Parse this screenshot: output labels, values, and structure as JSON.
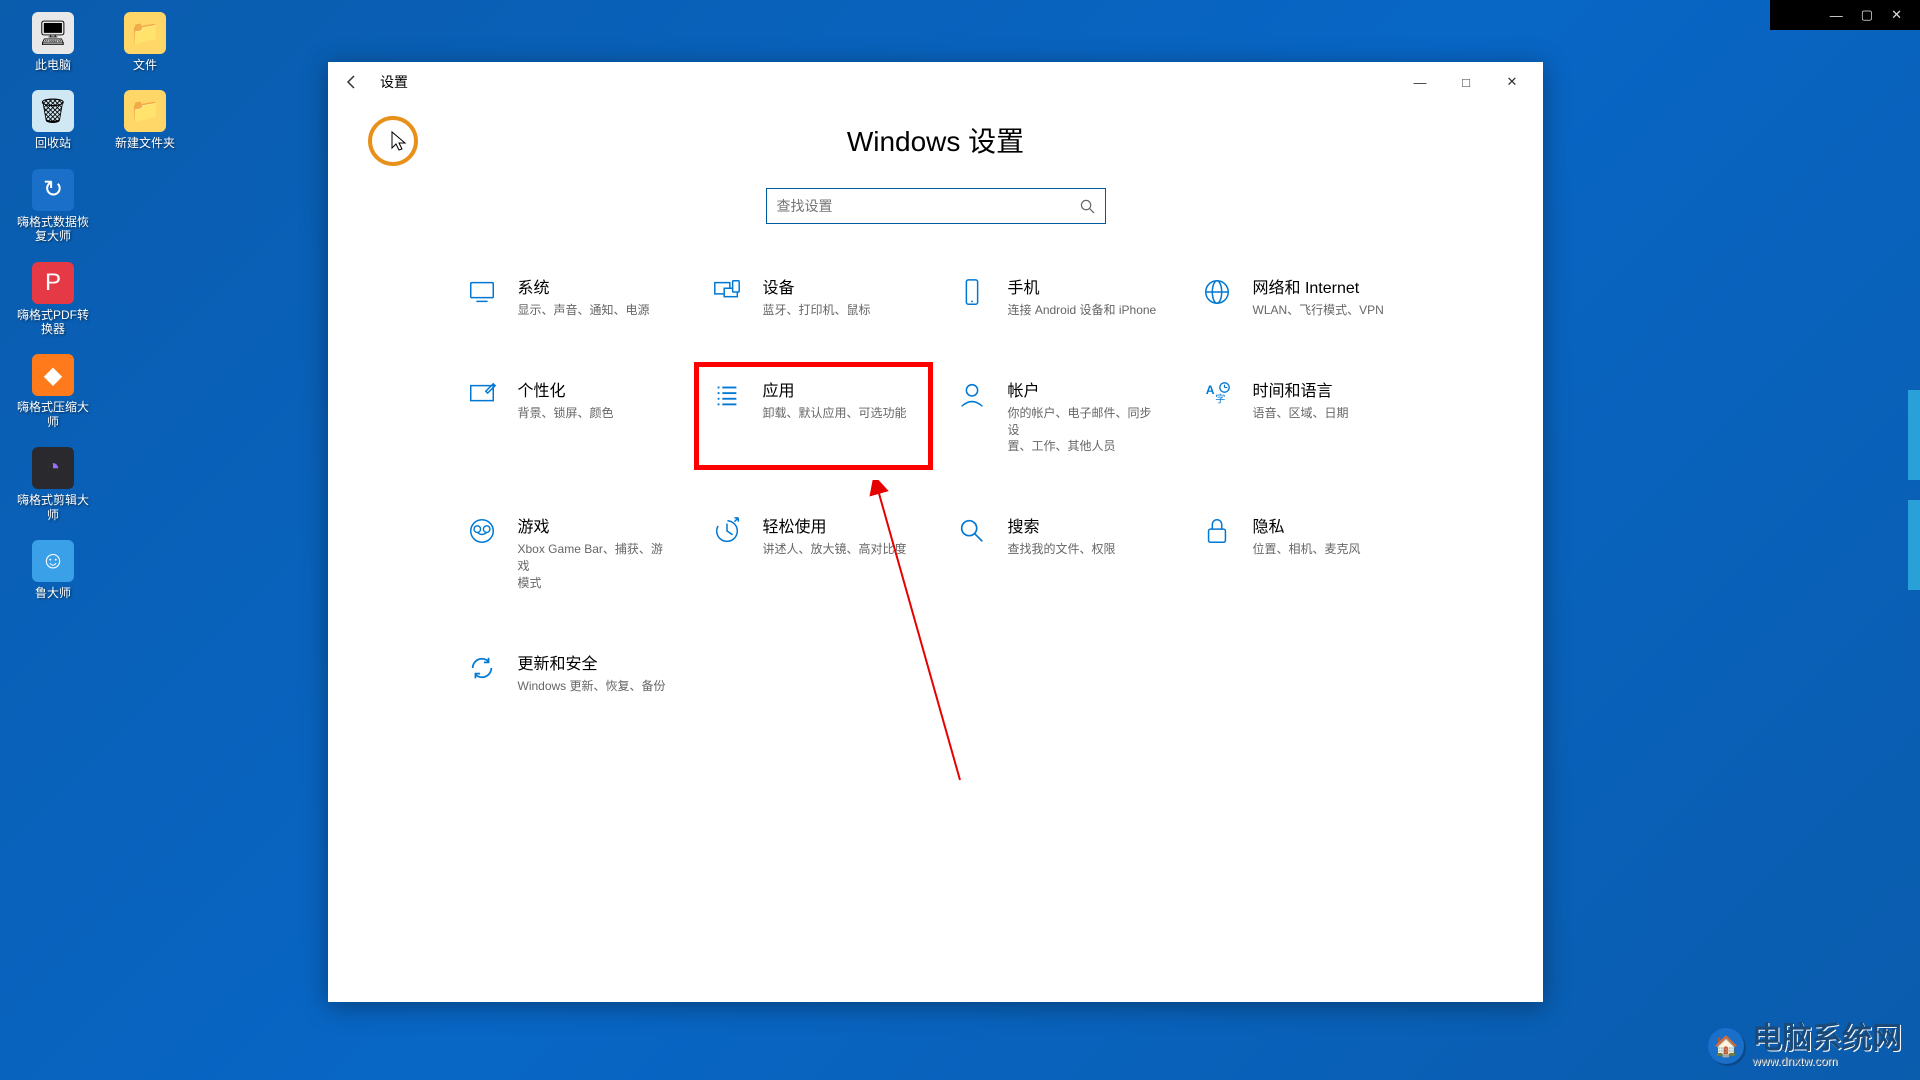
{
  "chrome": {
    "min": "—",
    "max": "▢",
    "close": "✕"
  },
  "desktop": [
    {
      "label": "此电脑",
      "cls": "ic-pc",
      "glyph": "🖥"
    },
    {
      "label": "文件",
      "cls": "ic-folder",
      "glyph": "📁"
    },
    {
      "label": "回收站",
      "cls": "ic-bin",
      "glyph": "🗑"
    },
    {
      "label": "新建文件夹",
      "cls": "ic-folder",
      "glyph": "📁"
    },
    {
      "label": "嗨格式数据恢\n复大师",
      "cls": "ic-blue",
      "glyph": "↻"
    },
    {
      "label": "嗨格式PDF转\n换器",
      "cls": "ic-red",
      "glyph": "P"
    },
    {
      "label": "嗨格式压缩大\n师",
      "cls": "ic-orange",
      "glyph": "◆"
    },
    {
      "label": "嗨格式剪辑大\n师",
      "cls": "ic-dark",
      "glyph": "◔"
    },
    {
      "label": "鲁大师",
      "cls": "ic-ava",
      "glyph": "☺"
    }
  ],
  "window": {
    "title": "设置",
    "heading": "Windows 设置",
    "search_placeholder": "查找设置",
    "minimize": "—",
    "maximize": "□",
    "close": "✕"
  },
  "categories": [
    {
      "title": "系统",
      "desc": "显示、声音、通知、电源",
      "icon": "system"
    },
    {
      "title": "设备",
      "desc": "蓝牙、打印机、鼠标",
      "icon": "devices"
    },
    {
      "title": "手机",
      "desc": "连接 Android 设备和 iPhone",
      "icon": "phone"
    },
    {
      "title": "网络和 Internet",
      "desc": "WLAN、飞行模式、VPN",
      "icon": "network"
    },
    {
      "title": "个性化",
      "desc": "背景、锁屏、颜色",
      "icon": "personalize"
    },
    {
      "title": "应用",
      "desc": "卸载、默认应用、可选功能",
      "icon": "apps",
      "highlight": true
    },
    {
      "title": "帐户",
      "desc": "你的帐户、电子邮件、同步设\n置、工作、其他人员",
      "icon": "accounts"
    },
    {
      "title": "时间和语言",
      "desc": "语音、区域、日期",
      "icon": "time"
    },
    {
      "title": "游戏",
      "desc": "Xbox Game Bar、捕获、游戏\n模式",
      "icon": "gaming"
    },
    {
      "title": "轻松使用",
      "desc": "讲述人、放大镜、高对比度",
      "icon": "ease"
    },
    {
      "title": "搜索",
      "desc": "查找我的文件、权限",
      "icon": "search"
    },
    {
      "title": "隐私",
      "desc": "位置、相机、麦克风",
      "icon": "privacy"
    },
    {
      "title": "更新和安全",
      "desc": "Windows 更新、恢复、备份",
      "icon": "update"
    }
  ],
  "watermark": {
    "text": "电脑系统网",
    "sub": "www.dnxtw.com"
  }
}
